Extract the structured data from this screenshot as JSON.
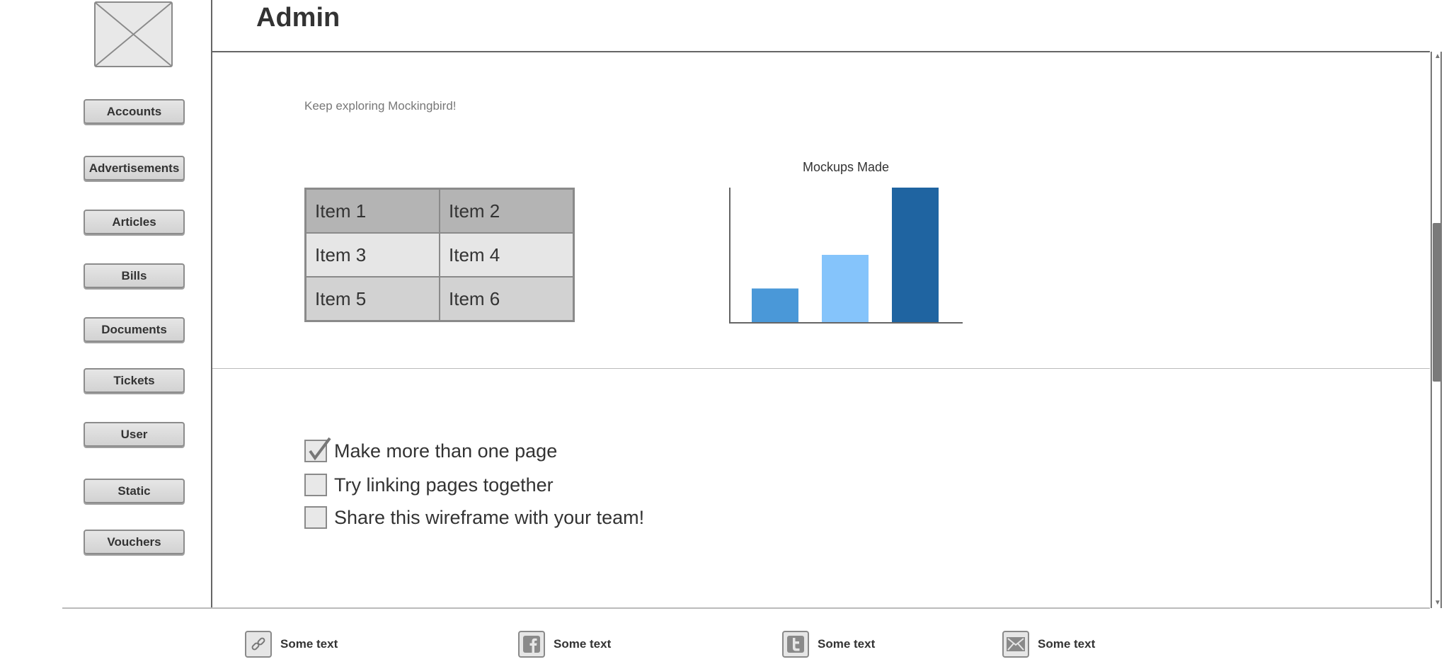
{
  "page": {
    "title": "Admin"
  },
  "sidebar": {
    "items": [
      {
        "label": "Accounts"
      },
      {
        "label": "Advertisements"
      },
      {
        "label": "Articles"
      },
      {
        "label": "Bills"
      },
      {
        "label": "Documents"
      },
      {
        "label": "Tickets"
      },
      {
        "label": "User"
      },
      {
        "label": "Static"
      },
      {
        "label": "Vouchers"
      }
    ]
  },
  "main": {
    "intro_text": "Keep exploring Mockingbird!",
    "grid_items": [
      "Item 1",
      "Item 2",
      "Item 3",
      "Item 4",
      "Item 5",
      "Item 6"
    ],
    "checklist": [
      {
        "label": "Make more than one page",
        "checked": true
      },
      {
        "label": "Try linking pages together",
        "checked": false
      },
      {
        "label": "Share this wireframe with your team!",
        "checked": false
      }
    ]
  },
  "chart_data": {
    "type": "bar",
    "title": "Mockups Made",
    "categories": [
      "",
      "",
      ""
    ],
    "values": [
      25,
      50,
      100
    ],
    "colors": [
      "#4a98d8",
      "#85c4fb",
      "#1f64a1"
    ],
    "ylim": [
      0,
      100
    ],
    "grid": false,
    "xlabel": "",
    "ylabel": ""
  },
  "footer": {
    "items": [
      {
        "icon": "link-icon",
        "text": "Some text"
      },
      {
        "icon": "facebook-icon",
        "text": "Some text"
      },
      {
        "icon": "twitter-icon",
        "text": "Some text"
      },
      {
        "icon": "mail-icon",
        "text": "Some text"
      }
    ]
  }
}
